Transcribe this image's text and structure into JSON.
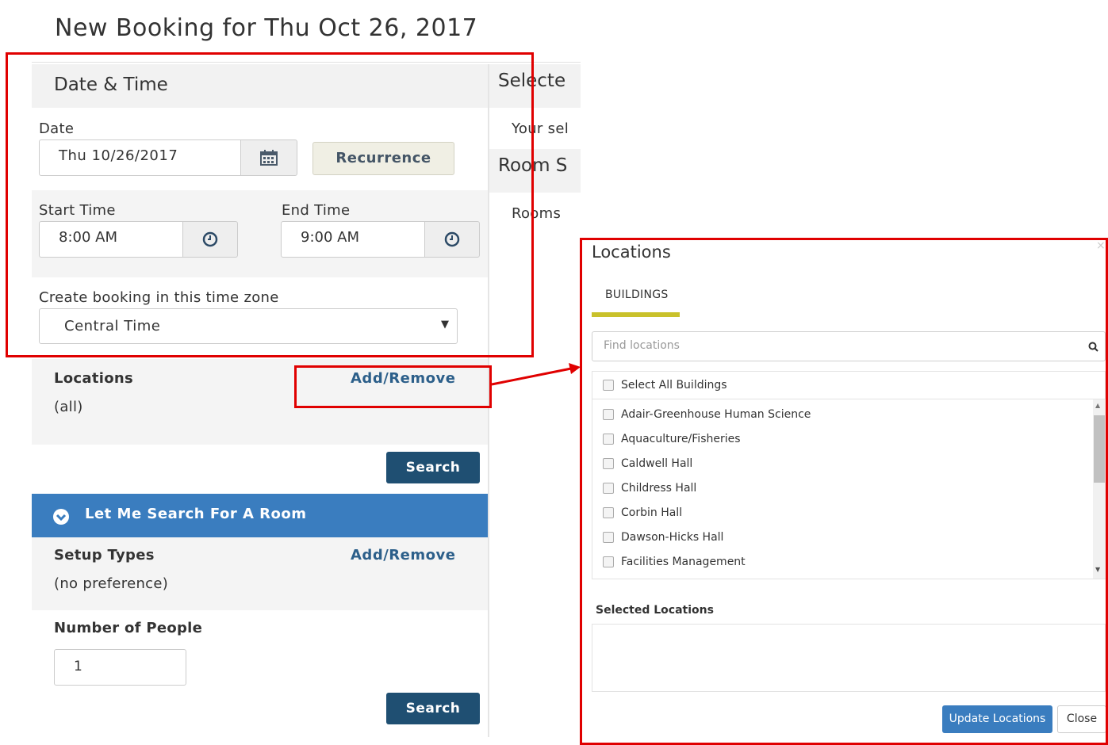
{
  "page": {
    "title": "New Booking for Thu Oct 26, 2017"
  },
  "datetime": {
    "section_title": "Date & Time",
    "date_label": "Date",
    "date_value": "Thu 10/26/2017",
    "recurrence_label": "Recurrence",
    "start_label": "Start Time",
    "start_value": "8:00 AM",
    "end_label": "End Time",
    "end_value": "9:00 AM",
    "timezone_label": "Create booking in this time zone",
    "timezone_value": "Central Time"
  },
  "locations": {
    "label": "Locations",
    "value": "(all)",
    "add_remove": "Add/Remove",
    "search_label": "Search"
  },
  "room_search": {
    "bar_label": "Let Me Search For A Room",
    "setup_label": "Setup Types",
    "setup_value": "(no preference)",
    "add_remove": "Add/Remove",
    "people_label": "Number of People",
    "people_value": "1",
    "search_label": "Search"
  },
  "right_panel": {
    "selected_head": "Selecte",
    "selected_text": "Your sel",
    "room_head": "Room S",
    "rooms_text": "Rooms"
  },
  "modal": {
    "title": "Locations",
    "close_glyph": "×",
    "tab_label": "BUILDINGS",
    "search_placeholder": "Find locations",
    "select_all_label": "Select All Buildings",
    "buildings": [
      "Adair-Greenhouse Human Science",
      "Aquaculture/Fisheries",
      "Caldwell Hall",
      "Childress Hall",
      "Corbin Hall",
      "Dawson-Hicks Hall",
      "Facilities Management"
    ],
    "selected_title": "Selected Locations",
    "update_label": "Update Locations",
    "close_label": "Close"
  },
  "colors": {
    "annotation_red": "#e00000",
    "primary_dark": "#1f4f72",
    "primary_blue": "#3a7dbf",
    "tab_accent": "#c9c12b",
    "link_blue": "#2c5f8a"
  },
  "icons": {
    "date_addon": "calendar-icon",
    "time_addon": "clock-icon",
    "select_caret": "caret-down-icon",
    "bar_toggle": "chevron-circle-down-icon",
    "modal_search": "search-icon",
    "annotation": "arrow-icon"
  }
}
